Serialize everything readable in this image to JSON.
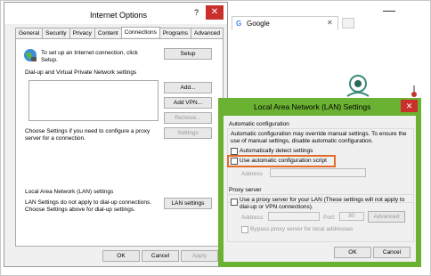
{
  "internet_options": {
    "title": "Internet Options",
    "help_label": "?",
    "close_label": "✕",
    "tabs": [
      "General",
      "Security",
      "Privacy",
      "Content",
      "Connections",
      "Programs",
      "Advanced"
    ],
    "active_tab": "Connections",
    "setup_text": "To set up an Internet connection, click Setup.",
    "setup_button": "Setup",
    "dialup_header": "Dial-up and Virtual Private Network settings",
    "add_button": "Add...",
    "add_vpn_button": "Add VPN...",
    "remove_button": "Remove...",
    "settings_text": "Choose Settings if you need to configure a proxy server for a connection.",
    "settings_button": "Settings",
    "lan_header": "Local Area Network (LAN) settings",
    "lan_text": "LAN Settings do not apply to dial-up connections. Choose Settings above for dial-up settings.",
    "lan_button": "LAN settings",
    "ok_button": "OK",
    "cancel_button": "Cancel",
    "apply_button": "Apply"
  },
  "browser": {
    "tab_title": "Google",
    "tab_close": "✕"
  },
  "lan_dialog": {
    "title": "Local Area Network (LAN) Settings",
    "close_label": "✕",
    "auto_config_header": "Automatic configuration",
    "auto_config_text": "Automatic configuration may override manual settings.  To ensure the use of manual settings, disable automatic configuration.",
    "auto_detect_label": "Automatically detect settings",
    "use_script_label": "Use automatic configuration script",
    "address_label": "Address",
    "proxy_header": "Proxy server",
    "use_proxy_label": "Use a proxy server for your LAN (These settings will not apply to dial-up or VPN connections).",
    "proxy_address_label": "Address:",
    "port_label": "Port:",
    "port_value": "80",
    "advanced_button": "Advanced",
    "bypass_label": "Bypass proxy server for local addresses",
    "ok_button": "OK",
    "cancel_button": "Cancel"
  },
  "colors": {
    "lan_border": "#6bb232",
    "highlight": "#e36c2b",
    "close_red": "#c9302c"
  }
}
